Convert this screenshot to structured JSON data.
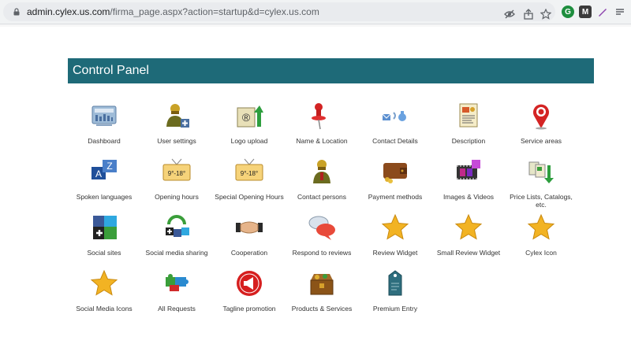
{
  "browser": {
    "url_host": "admin.cylex.us.com",
    "url_path": "/firma_page.aspx?action=startup&d=cylex.us.com"
  },
  "panel": {
    "title": "Control Panel",
    "items": [
      {
        "label": "Dashboard",
        "icon": "dashboard-icon"
      },
      {
        "label": "User settings",
        "icon": "user-settings-icon"
      },
      {
        "label": "Logo upload",
        "icon": "logo-upload-icon"
      },
      {
        "label": "Name & Location",
        "icon": "pushpin-icon"
      },
      {
        "label": "Contact Details",
        "icon": "contact-details-icon"
      },
      {
        "label": "Description",
        "icon": "description-icon"
      },
      {
        "label": "Service areas",
        "icon": "map-pin-icon"
      },
      {
        "label": "Spoken languages",
        "icon": "languages-icon"
      },
      {
        "label": "Opening hours",
        "icon": "opening-hours-icon"
      },
      {
        "label": "Special Opening Hours",
        "icon": "special-opening-hours-icon"
      },
      {
        "label": "Contact persons",
        "icon": "contact-persons-icon"
      },
      {
        "label": "Payment methods",
        "icon": "wallet-icon"
      },
      {
        "label": "Images & Videos",
        "icon": "film-icon"
      },
      {
        "label": "Price Lists, Catalogs, etc.",
        "icon": "price-list-icon"
      },
      {
        "label": "Social sites",
        "icon": "social-sites-icon"
      },
      {
        "label": "Social media sharing",
        "icon": "social-sharing-icon"
      },
      {
        "label": "Cooperation",
        "icon": "handshake-icon"
      },
      {
        "label": "Respond to reviews",
        "icon": "speech-bubbles-icon"
      },
      {
        "label": "Review Widget",
        "icon": "star-icon"
      },
      {
        "label": "Small Review Widget",
        "icon": "star-icon"
      },
      {
        "label": "Cylex Icon",
        "icon": "star-icon"
      },
      {
        "label": "Social Media Icons",
        "icon": "star-icon"
      },
      {
        "label": "All Requests",
        "icon": "puzzle-icon"
      },
      {
        "label": "Tagline promotion",
        "icon": "megaphone-icon"
      },
      {
        "label": "Products & Services",
        "icon": "treasure-box-icon"
      },
      {
        "label": "Premium Entry",
        "icon": "tag-icon"
      }
    ],
    "opening_hours_text": "9°-18°"
  },
  "colors": {
    "header": "#1e6a78",
    "label": "#333333"
  }
}
